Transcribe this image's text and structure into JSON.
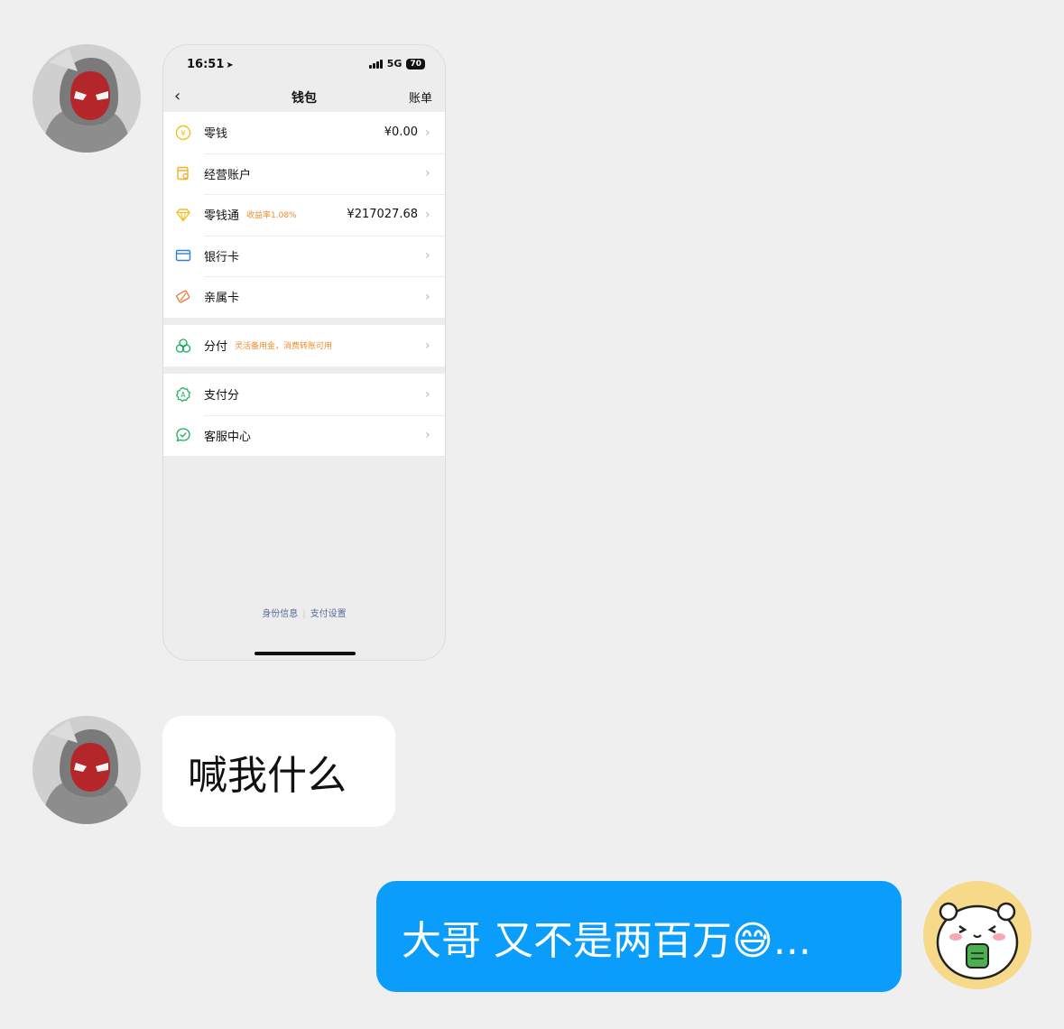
{
  "phone": {
    "status_time": "16:51",
    "status_network": "5G",
    "battery": "70",
    "nav_title": "钱包",
    "nav_right": "账单",
    "group1": [
      {
        "label": "零钱",
        "value": "¥0.00",
        "icon": "coin-icon"
      },
      {
        "label": "经营账户",
        "icon": "business-account-icon"
      },
      {
        "label": "零钱通",
        "tag": "收益率1.08%",
        "value": "¥217027.68",
        "icon": "diamond-icon"
      },
      {
        "label": "银行卡",
        "icon": "bank-card-icon"
      },
      {
        "label": "亲属卡",
        "icon": "family-card-icon"
      }
    ],
    "group2": [
      {
        "label": "分付",
        "tag": "灵活备用金，消费转账可用",
        "icon": "fenfu-icon"
      }
    ],
    "group3": [
      {
        "label": "支付分",
        "icon": "pay-score-icon"
      },
      {
        "label": "客服中心",
        "icon": "service-center-icon"
      }
    ],
    "footer_link1": "身份信息",
    "footer_link2": "支付设置"
  },
  "messages": {
    "received": "喊我什么",
    "sent": "大哥 又不是两百万😅..."
  },
  "colors": {
    "background": "#efefef",
    "sent_bubble": "#0a9dfb",
    "received_bubble": "#ffffff",
    "accent_tag": "#f08c2a",
    "link": "#576b95"
  }
}
